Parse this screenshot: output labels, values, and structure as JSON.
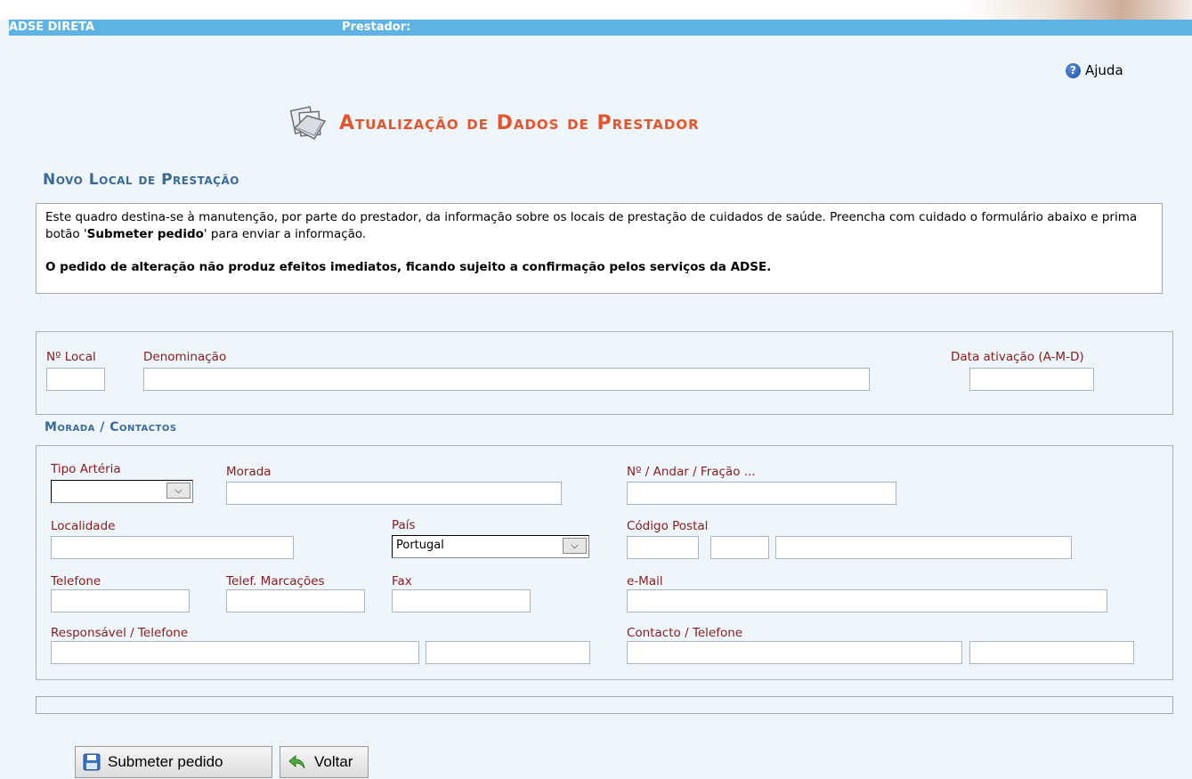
{
  "header": {
    "app_name": "ADSE DIRETA",
    "provider_label": "Prestador:"
  },
  "help": {
    "label": "Ajuda"
  },
  "page_title": "Atualização de Dados de Prestador",
  "section_title": "Novo Local de Prestação",
  "info": {
    "line1_pre": "Este quadro destina-se à manutenção, por parte do prestador, da informação sobre os locais de prestação de cuidados de saúde. Preencha com cuidado o formulário abaixo e prima botão '",
    "line1_bold": "Submeter pedido",
    "line1_post": "' para enviar a informação.",
    "notice": "O pedido de alteração não produz efeitos imediatos, ficando sujeito a confirmação pelos serviços da ADSE."
  },
  "local": {
    "num_label": "Nº Local",
    "name_label": "Denominação",
    "date_label": "Data ativação (A-M-D)"
  },
  "contacts_title": "Morada / Contactos",
  "address": {
    "street_type_label": "Tipo Artéria",
    "street_type_value": "",
    "address_label": "Morada",
    "number_label": "Nº / Andar / Fração ...",
    "locality_label": "Localidade",
    "country_label": "País",
    "country_value": "Portugal",
    "postal_label": "Código Postal",
    "phone_label": "Telefone",
    "phone_booking_label": "Telef. Marcações",
    "fax_label": "Fax",
    "email_label": "e-Mail",
    "responsible_label": "Responsável / Telefone",
    "contact_label": "Contacto / Telefone"
  },
  "buttons": {
    "submit": "Submeter pedido",
    "back": "Voltar"
  },
  "colors": {
    "top_bar": "#5fb3e4",
    "title": "#e8542a",
    "section": "#3a6a9a",
    "label": "#8b1a1a",
    "background": "#eef6fc"
  },
  "icons": [
    "help-icon",
    "documents-icon",
    "floppy-disk-icon",
    "back-arrow-icon",
    "chevron-down-icon"
  ]
}
